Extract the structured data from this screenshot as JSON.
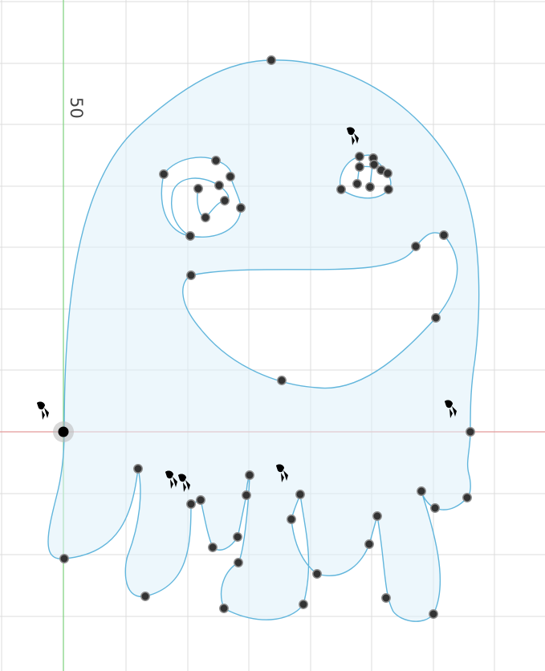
{
  "sketch": {
    "dimension_label": "50",
    "colors": {
      "background": "#ffffff",
      "grid": "#dcdcdc",
      "profile_stroke": "#62b6dc",
      "profile_fill": "#e6f4fb",
      "x_axis": "#e08a8a",
      "y_axis": "#7fd07f",
      "point": "#333333",
      "origin": "#000000"
    },
    "constraint_icon": "fix-constraint-icon",
    "point_icon": "sketch-point-icon",
    "origin_icon": "origin-point-icon"
  }
}
